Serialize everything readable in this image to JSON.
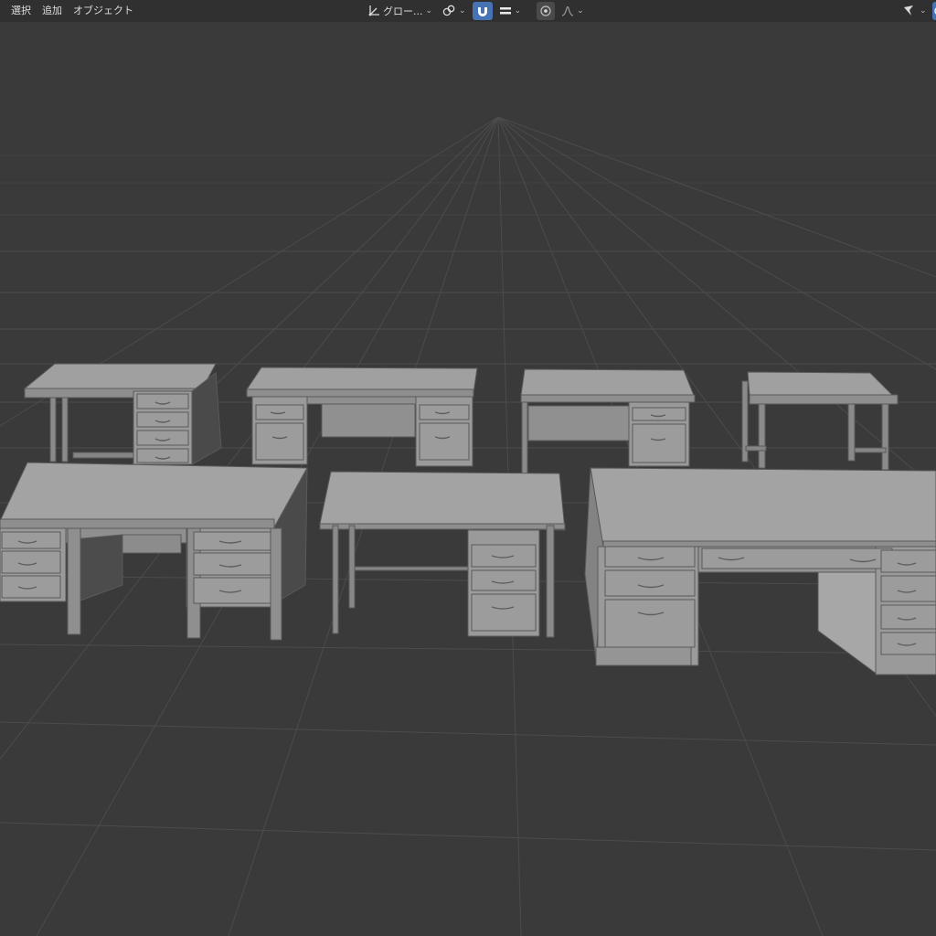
{
  "menu": {
    "items": [
      {
        "name": "menu-select",
        "label": "選択"
      },
      {
        "name": "menu-add",
        "label": "追加"
      },
      {
        "name": "menu-object",
        "label": "オブジェクト"
      }
    ]
  },
  "toolbar": {
    "orientation_label": "グロー...",
    "icons": {
      "orientation": "transform-orientation-icon",
      "pivot": "pivot-point-icon",
      "snap": "snap-magnet-icon",
      "snap_target": "snap-increment-icon",
      "proportional": "proportional-edit-icon",
      "falloff": "falloff-curve-icon",
      "select_mode": "select-tool-icon",
      "overlay": "overlay-icon"
    }
  },
  "colors": {
    "header_bg": "#303030",
    "viewport_bg": "#3a3a3a",
    "grid": "#4a4a4a",
    "accent": "#4772b3",
    "model": "#9a9a9a"
  }
}
